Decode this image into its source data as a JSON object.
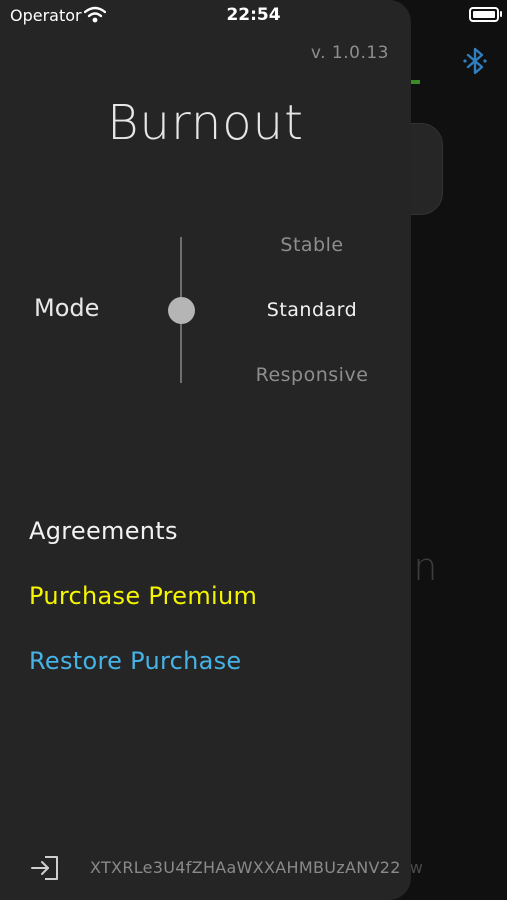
{
  "status_bar": {
    "carrier": "Operator",
    "time": "22:54"
  },
  "background_app": {
    "login_text": "gin",
    "bottom_text": "ow",
    "bluetooth_icon": "bluetooth-icon",
    "accent_color": "#3a8a2a"
  },
  "drawer": {
    "version": "v. 1.0.13",
    "title": "Burnout",
    "mode": {
      "label": "Mode",
      "options": [
        "Stable",
        "Standard",
        "Responsive"
      ],
      "selected": "Standard"
    },
    "menu": {
      "agreements": "Agreements",
      "purchase_premium": "Purchase Premium",
      "restore_purchase": "Restore Purchase"
    },
    "colors": {
      "purchase_premium": "#f5f500",
      "restore_purchase": "#46b3e6"
    },
    "footer": {
      "logout_icon": "logout-icon",
      "device_id": "XTXRLe3U4fZHAaWXXAHMBUzANV22"
    }
  }
}
